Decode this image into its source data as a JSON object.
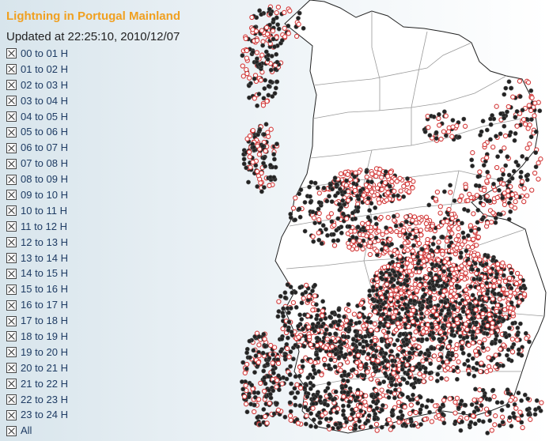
{
  "page": {
    "title": "Lightning in Portugal Mainland",
    "updated": "Updated at 22:25:10, 2010/12/07"
  },
  "hours": [
    {
      "label": "00 to 01 H",
      "checked": true
    },
    {
      "label": "01 to 02 H",
      "checked": true
    },
    {
      "label": "02 to 03 H",
      "checked": true
    },
    {
      "label": "03 to 04 H",
      "checked": true
    },
    {
      "label": "04 to 05 H",
      "checked": true
    },
    {
      "label": "05 to 06 H",
      "checked": true
    },
    {
      "label": "06 to 07 H",
      "checked": true
    },
    {
      "label": "07 to 08 H",
      "checked": true
    },
    {
      "label": "08 to 09 H",
      "checked": true
    },
    {
      "label": "09 to 10 H",
      "checked": true
    },
    {
      "label": "10 to 11 H",
      "checked": true
    },
    {
      "label": "11 to 12 H",
      "checked": true
    },
    {
      "label": "12 to 13 H",
      "checked": true
    },
    {
      "label": "13 to 14 H",
      "checked": true
    },
    {
      "label": "14 to 15 H",
      "checked": true
    },
    {
      "label": "15 to 16 H",
      "checked": true
    },
    {
      "label": "16 to 17 H",
      "checked": true
    },
    {
      "label": "17 to 18 H",
      "checked": true
    },
    {
      "label": "18 to 19 H",
      "checked": true
    },
    {
      "label": "19 to 20 H",
      "checked": true
    },
    {
      "label": "20 to 21 H",
      "checked": true
    },
    {
      "label": "21 to 22 H",
      "checked": true
    },
    {
      "label": "22 to 23 H",
      "checked": true
    },
    {
      "label": "23 to 24 H",
      "checked": true
    },
    {
      "label": "All",
      "checked": true
    }
  ],
  "map": {
    "land_color": "#ffffff",
    "sea_color": "#eef3f6",
    "border_color": "#9a9a9a",
    "coast_color": "#222222",
    "positive_strike_color": "#d33a3a",
    "negative_strike_color": "#222222"
  }
}
